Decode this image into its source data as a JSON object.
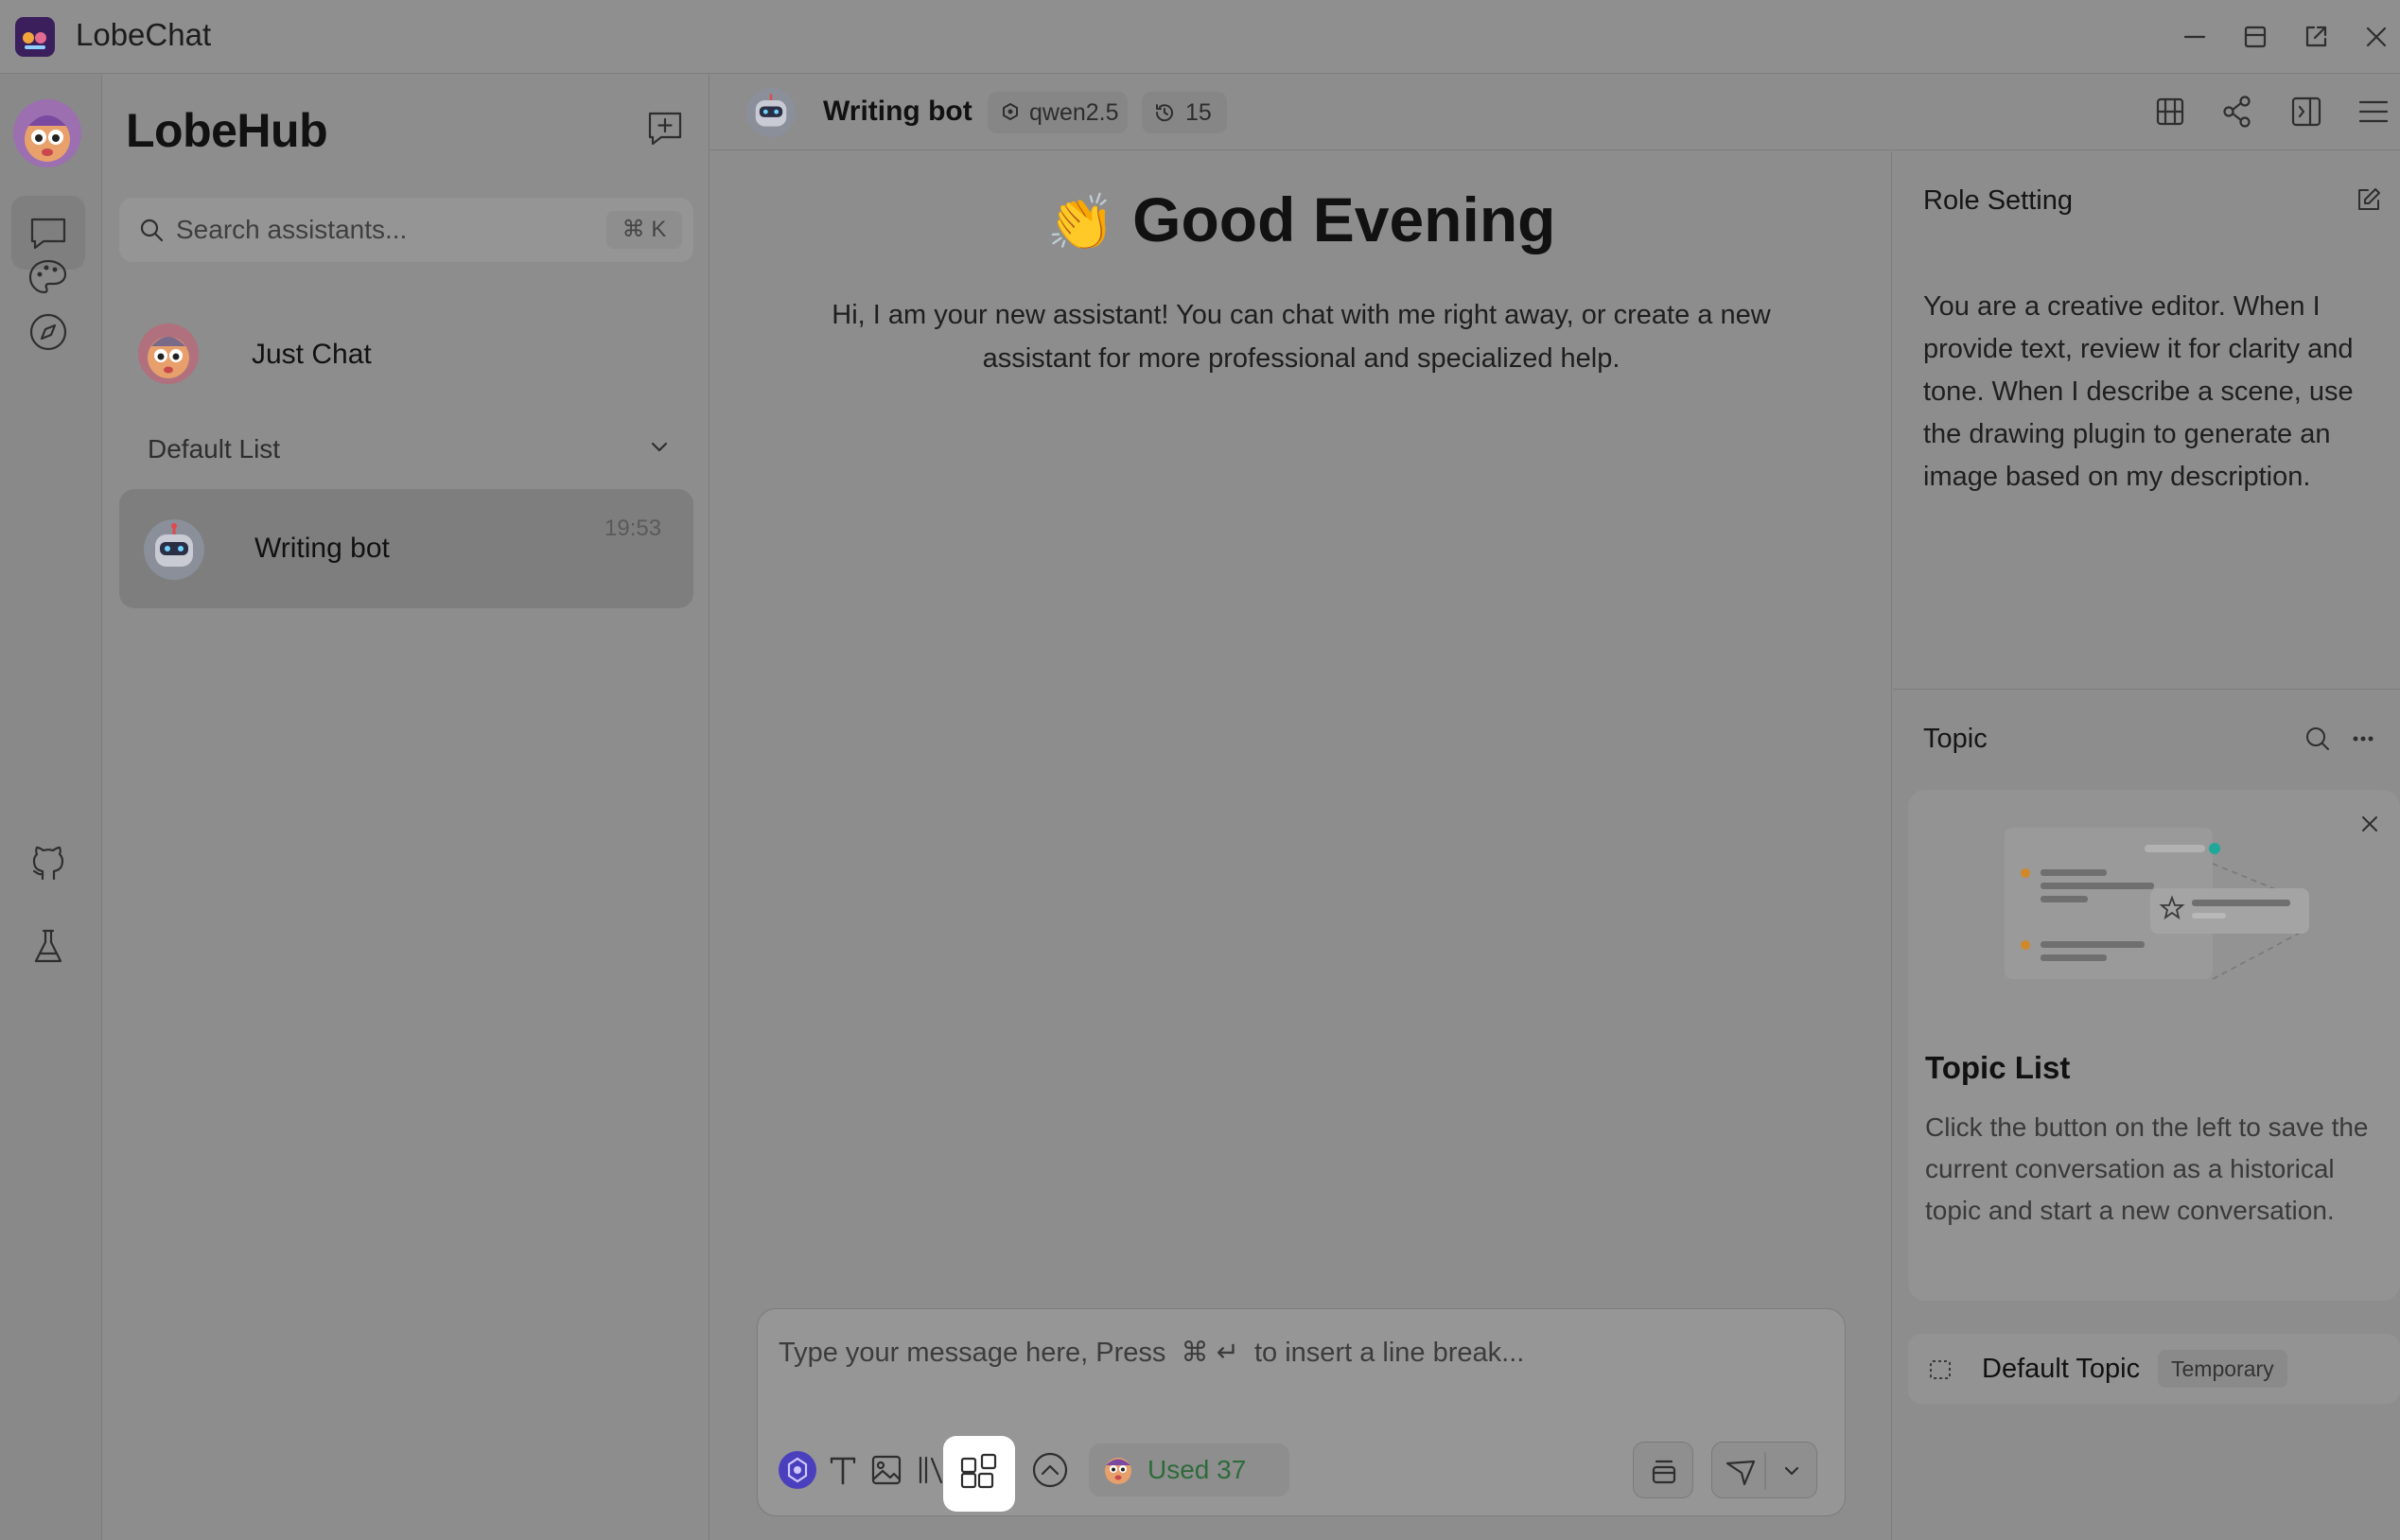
{
  "window": {
    "title": "LobeChat"
  },
  "sessions": {
    "brand": "LobeHub",
    "search_placeholder": "Search assistants...",
    "search_shortcut": "⌘ K",
    "just_chat": "Just Chat",
    "group_label": "Default List",
    "items": [
      {
        "name": "Writing bot",
        "time": "19:53"
      }
    ]
  },
  "header": {
    "agent_name": "Writing bot",
    "model": "qwen2.5",
    "history_count": "15"
  },
  "chat": {
    "greeting_emoji": "👏",
    "greeting": "Good Evening",
    "intro": "Hi, I am your new assistant! You can chat with me right away, or create a new assistant for more professional and specialized help.",
    "input_placeholder": "Type your message here, Press  ⌘ ↵  to insert a line break...",
    "tokens_used": "Used 37"
  },
  "role": {
    "title": "Role Setting",
    "text": "You are a creative editor. When I provide text, review it for clarity and tone. When I describe a scene, use the drawing plugin to generate an image based on my description."
  },
  "topic": {
    "title": "Topic",
    "card_title": "Topic List",
    "card_text": "Click the button on the left to save the current conversation as a historical topic and start a new conversation.",
    "default_topic": "Default Topic",
    "temporary_badge": "Temporary"
  },
  "colors": {
    "accent": "#4a3fbd",
    "used_green": "#2e6b3a",
    "teal_dot": "#1fa89a",
    "orange_dot": "#d0882a"
  }
}
